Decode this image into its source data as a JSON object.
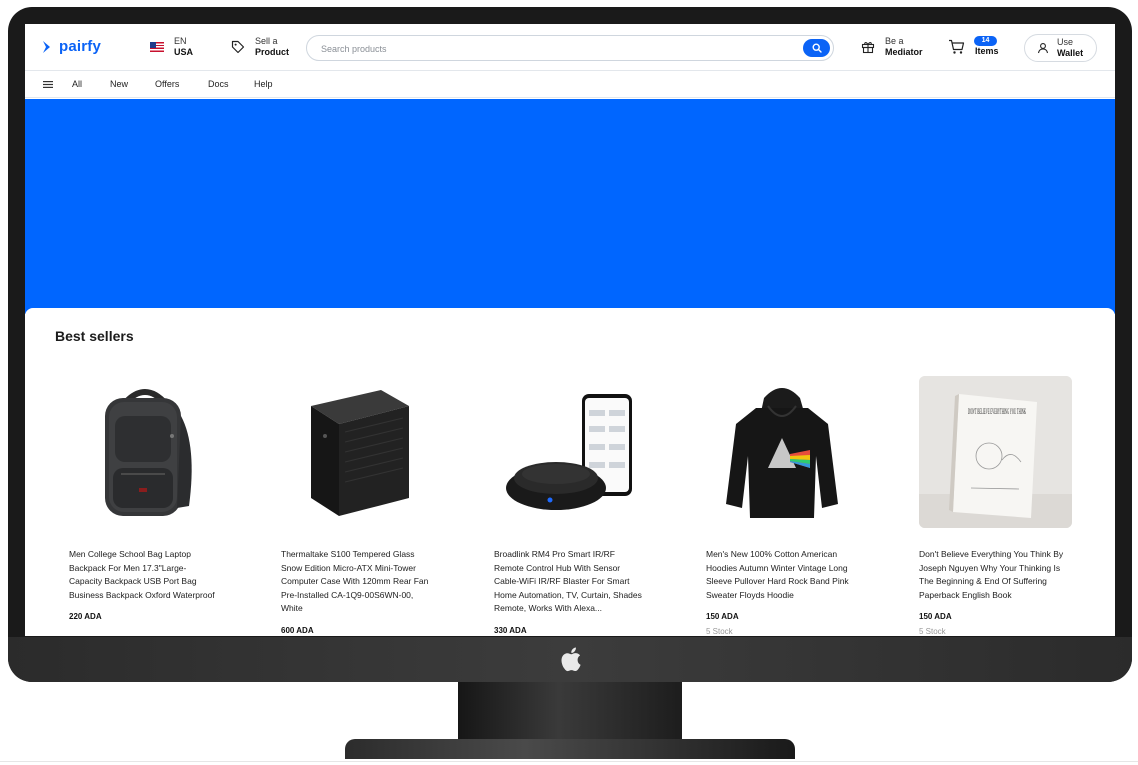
{
  "header": {
    "logo": "pairfy",
    "language": {
      "code": "EN",
      "region": "USA"
    },
    "sell": {
      "line1": "Sell a",
      "line2": "Product"
    },
    "search": {
      "placeholder": "Search products",
      "value": ""
    },
    "mediator": {
      "line1": "Be a",
      "line2": "Mediator"
    },
    "cart": {
      "count": "14",
      "label": "Items"
    },
    "wallet": {
      "line1": "Use",
      "line2": "Wallet"
    }
  },
  "nav": {
    "items": [
      "All",
      "New",
      "Offers",
      "Docs",
      "Help"
    ]
  },
  "best_sellers": {
    "title": "Best sellers",
    "products": [
      {
        "name": "Men College School Bag Laptop Backpack For Men 17.3\"Large-Capacity Backpack USB Port Bag Business Backpack Oxford Waterproof",
        "price": "220 ADA",
        "stock": ""
      },
      {
        "name": "Thermaltake S100 Tempered Glass Snow Edition Micro-ATX Mini-Tower Computer Case With 120mm Rear Fan Pre-Installed CA-1Q9-00S6WN-00, White",
        "price": "600 ADA",
        "stock": ""
      },
      {
        "name": "Broadlink RM4 Pro Smart IR/RF Remote Control Hub With Sensor Cable-WiFi IR/RF Blaster For Smart Home Automation, TV, Curtain, Shades Remote, Works With Alexa...",
        "price": "330 ADA",
        "stock": ""
      },
      {
        "name": "Men's New 100% Cotton American Hoodies Autumn Winter Vintage Long Sleeve Pullover Hard Rock Band Pink Sweater Floyds Hoodie",
        "price": "150 ADA",
        "stock": "5 Stock"
      },
      {
        "name": "Don't Believe Everything You Think By Joseph Nguyen Why Your Thinking Is The Beginning & End Of Suffering Paperback English Book",
        "price": "150 ADA",
        "stock": "5 Stock",
        "cover_text": "DON'T BELIEVE EVERYTHING YOU THINK"
      }
    ]
  },
  "colors": {
    "accent": "#0b63f6",
    "hero": "#0066ff"
  }
}
